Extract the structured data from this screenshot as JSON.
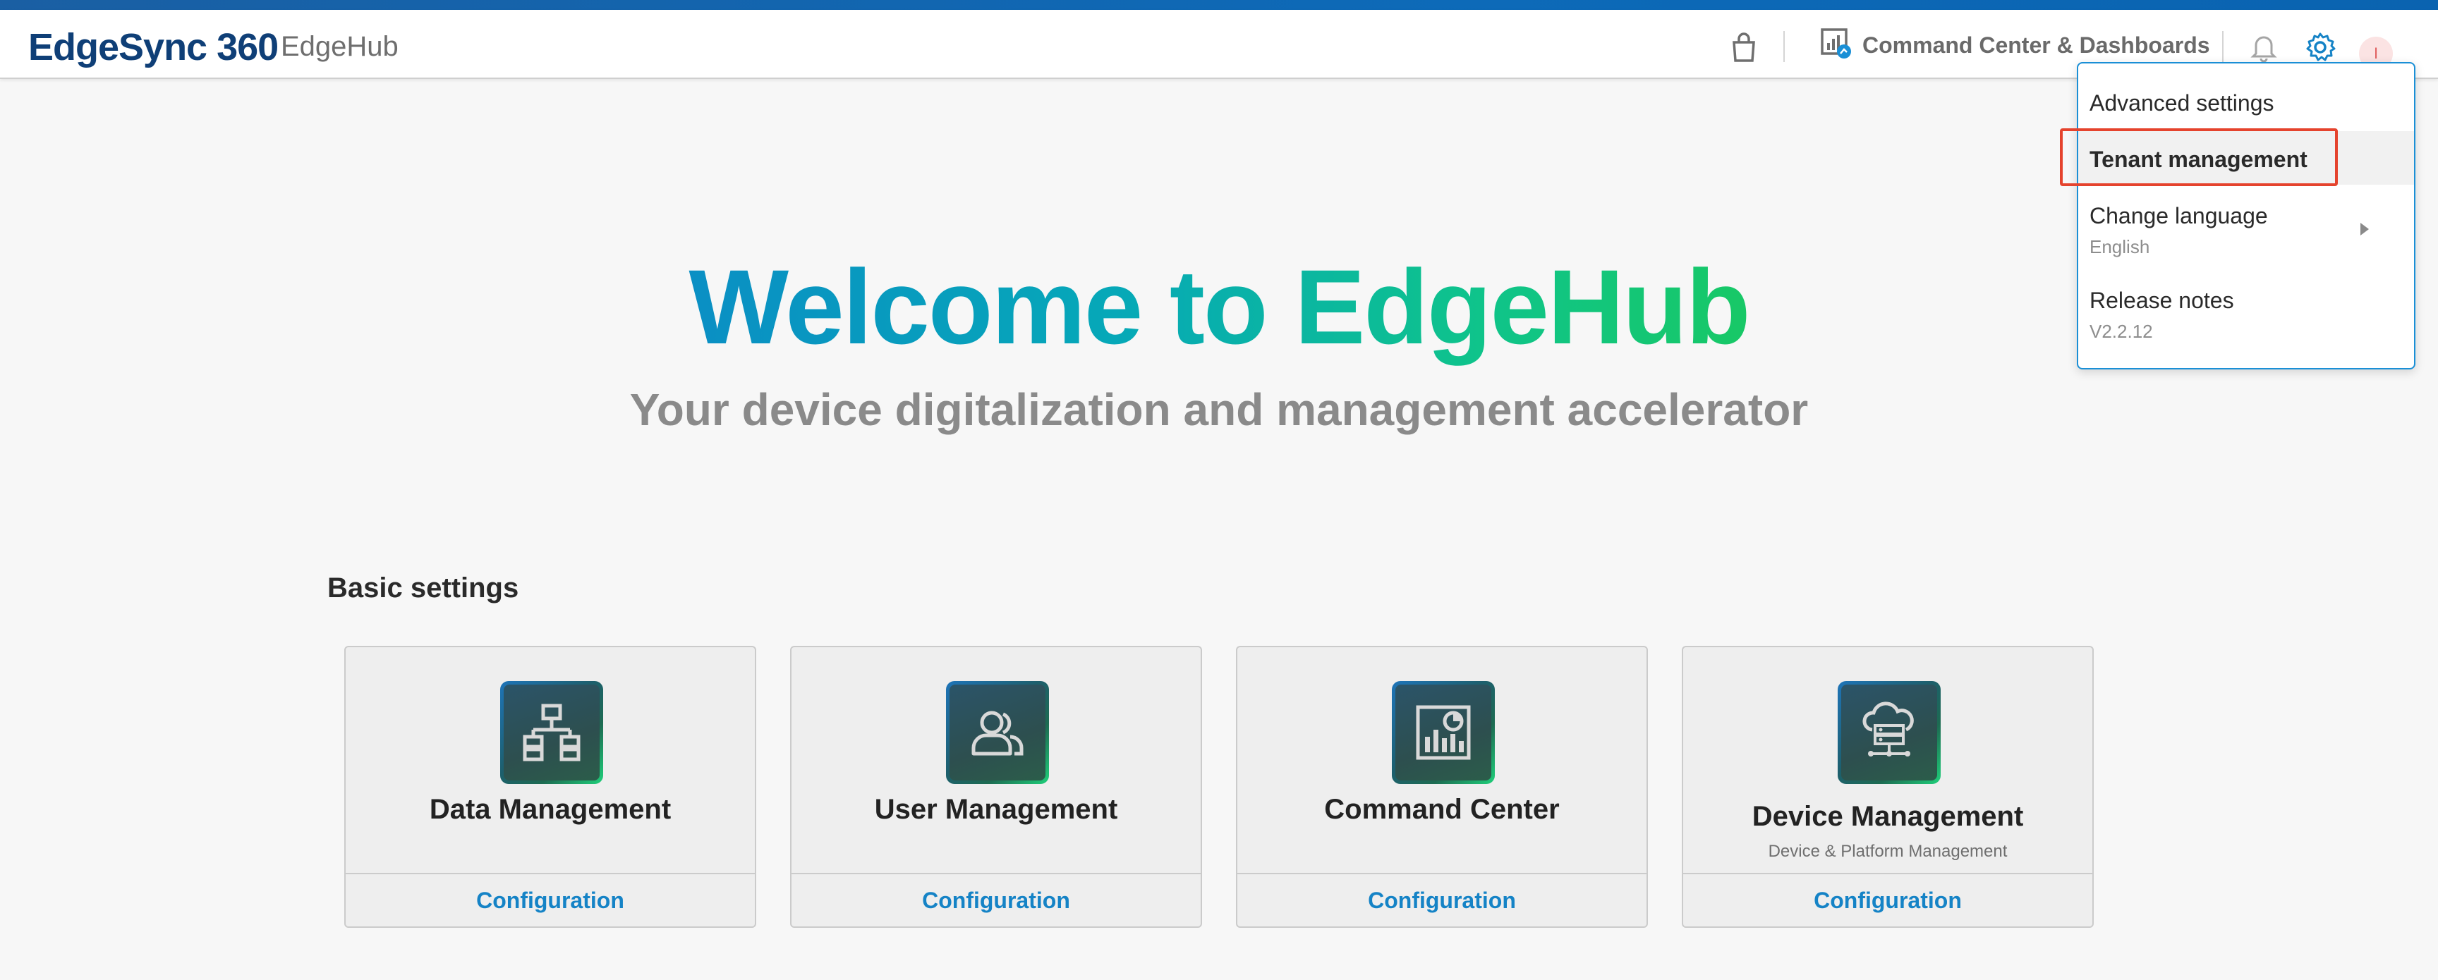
{
  "header": {
    "brand": "EdgeSync 360",
    "app_name": "EdgeHub",
    "command_link_label": "Command Center & Dashboards",
    "avatar_initial": "I"
  },
  "hero": {
    "title": "Welcome to EdgeHub",
    "subtitle": "Your device digitalization and management accelerator"
  },
  "basic_settings": {
    "title": "Basic settings",
    "cards": [
      {
        "title": "Data Management",
        "subtitle": "",
        "action": "Configuration",
        "icon": "hierarchy-icon"
      },
      {
        "title": "User Management",
        "subtitle": "",
        "action": "Configuration",
        "icon": "users-icon"
      },
      {
        "title": "Command Center",
        "subtitle": "",
        "action": "Configuration",
        "icon": "dashboard-chart-icon"
      },
      {
        "title": "Device Management",
        "subtitle": "Device & Platform Management",
        "action": "Configuration",
        "icon": "cloud-server-icon"
      }
    ]
  },
  "settings_menu": {
    "items": [
      {
        "label": "Advanced settings",
        "sub": ""
      },
      {
        "label": "Tenant management",
        "sub": ""
      },
      {
        "label": "Change language",
        "sub": "English"
      },
      {
        "label": "Release notes",
        "sub": "V2.2.12"
      }
    ]
  },
  "colors": {
    "accent": "#1583c6",
    "brand": "#0f3f77",
    "highlight_box": "#e5432d"
  }
}
